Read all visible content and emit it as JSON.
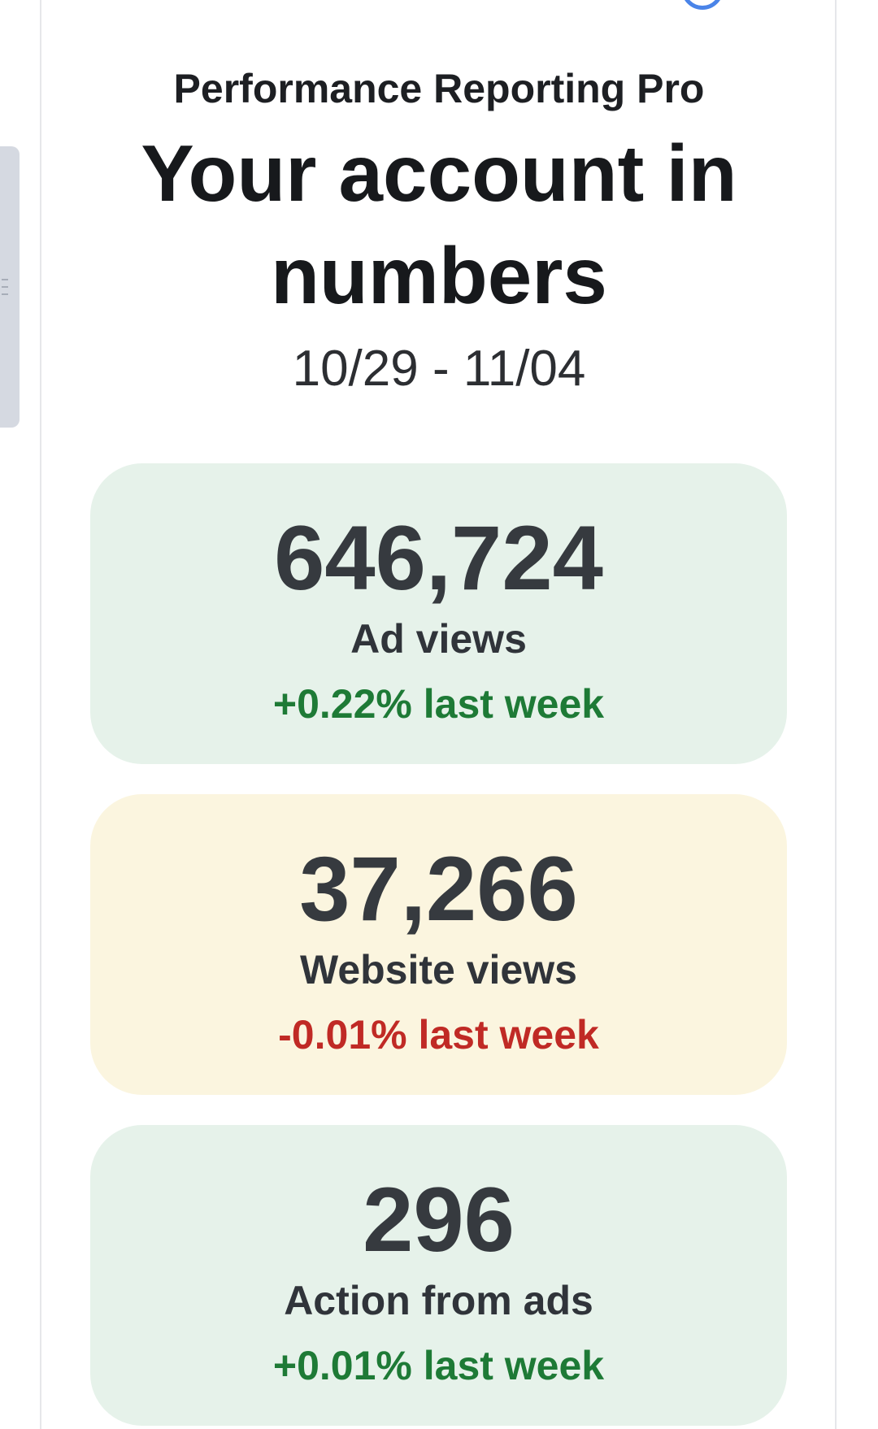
{
  "app_name": "Performance Reporting Pro",
  "headline_line1": "Your account in",
  "headline_line2": "numbers",
  "date_range": "10/29 - 11/04",
  "metrics": [
    {
      "value": "646,724",
      "label": "Ad views",
      "change": "+0.22% last week",
      "trend": "up",
      "card_color": "#e6f2ea",
      "change_color": "#1e7a36"
    },
    {
      "value": "37,266",
      "label": "Website views",
      "change": "-0.01% last week",
      "trend": "down",
      "card_color": "#fbf5df",
      "change_color": "#c02a25"
    },
    {
      "value": "296",
      "label": "Action from ads",
      "change": "+0.01% last week",
      "trend": "up",
      "card_color": "#e6f2ea",
      "change_color": "#1e7a36"
    }
  ],
  "icons": {
    "top_icon": "account-circle-icon",
    "side_handle": "drag-handle-icon"
  }
}
